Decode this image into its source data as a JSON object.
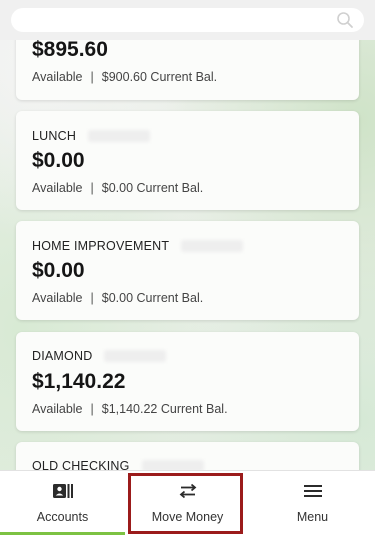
{
  "search": {
    "icon": "search-icon"
  },
  "accounts": [
    {
      "name": "",
      "amount": "$895.60",
      "available_label": "Available",
      "separator": "|",
      "current_balance": "$900.60 Current Bal."
    },
    {
      "name": "LUNCH",
      "amount": "$0.00",
      "available_label": "Available",
      "separator": "|",
      "current_balance": "$0.00 Current Bal."
    },
    {
      "name": "HOME IMPROVEMENT",
      "amount": "$0.00",
      "available_label": "Available",
      "separator": "|",
      "current_balance": "$0.00 Current Bal."
    },
    {
      "name": "DIAMOND",
      "amount": "$1,140.22",
      "available_label": "Available",
      "separator": "|",
      "current_balance": "$1,140.22 Current Bal."
    },
    {
      "name": "OLD CHECKING",
      "amount": "",
      "available_label": "",
      "separator": "",
      "current_balance": ""
    }
  ],
  "bottom_nav": {
    "items": [
      {
        "label": "Accounts",
        "icon": "accounts-icon",
        "active": true
      },
      {
        "label": "Move Money",
        "icon": "transfer-arrows-icon",
        "active": false
      },
      {
        "label": "Menu",
        "icon": "hamburger-menu-icon",
        "active": false
      }
    ]
  },
  "colors": {
    "active_underline": "#7cc242",
    "highlight_box": "#9b1b1b"
  }
}
